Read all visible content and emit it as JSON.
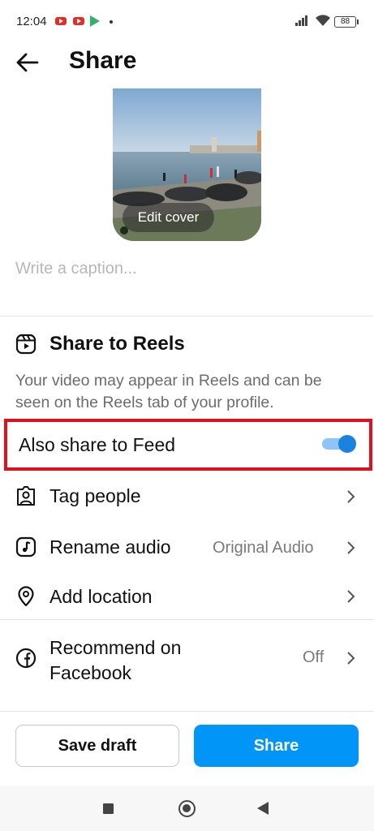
{
  "status_bar": {
    "time": "12:04",
    "battery": "88",
    "icons": [
      "youtube-icon",
      "youtube-icon",
      "play-store-icon",
      "dot-icon",
      "signal-icon",
      "wifi-icon",
      "battery-icon"
    ]
  },
  "header": {
    "title": "Share",
    "back_icon": "arrow-left-icon"
  },
  "cover": {
    "edit_label": "Edit cover"
  },
  "caption": {
    "placeholder": "Write a caption..."
  },
  "reels": {
    "title": "Share to Reels",
    "description": "Your video may appear in Reels and can be seen on the Reels tab of your profile."
  },
  "feed": {
    "label": "Also share to Feed",
    "enabled": true,
    "accent": "#1b82e0",
    "highlight": "#e0111d"
  },
  "rows": [
    {
      "label": "Tag people",
      "value": "",
      "icon": "tag-person-icon"
    },
    {
      "label": "Rename audio",
      "value": "Original Audio",
      "icon": "audio-icon"
    },
    {
      "label": "Add location",
      "value": "",
      "icon": "location-pin-icon"
    },
    {
      "label": "Recommend on Facebook",
      "value": "Off",
      "icon": "facebook-icon"
    }
  ],
  "buttons": {
    "save_draft": "Save draft",
    "share": "Share",
    "share_color": "#0095f6"
  }
}
